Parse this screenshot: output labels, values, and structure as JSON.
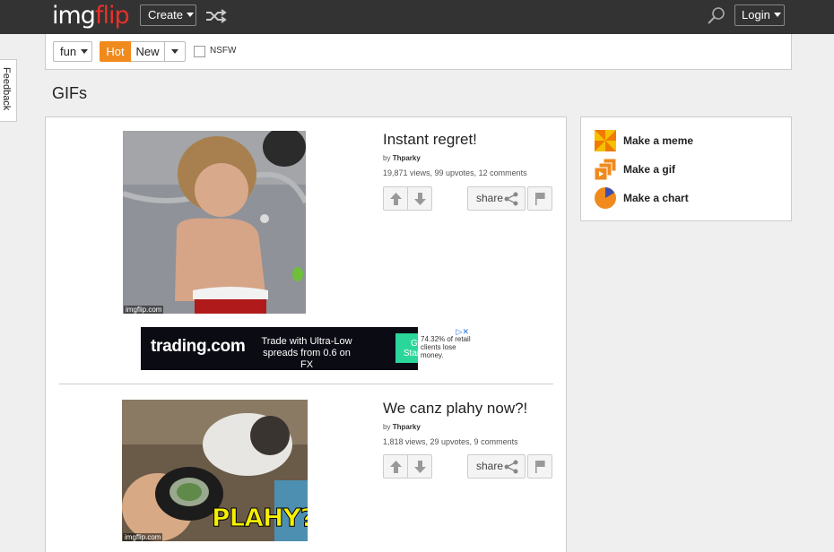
{
  "header": {
    "logo_part1": "img",
    "logo_part2": "flip",
    "create_label": "Create",
    "login_label": "Login"
  },
  "feedback_label": "Feedback",
  "filters": {
    "category": "fun",
    "hot_label": "Hot",
    "new_label": "New",
    "nsfw_label": "NSFW"
  },
  "page_title": "GIFs",
  "posts": [
    {
      "title": "Instant regret!",
      "by_prefix": "by",
      "author": "Thparky",
      "stats": "19,871 views, 99 upvotes, 12 comments",
      "share_label": "share",
      "watermark": "imgflip.com"
    },
    {
      "title": "We canz plahy now?!",
      "by_prefix": "by",
      "author": "Thparky",
      "stats": "1,818 views, 29 upvotes, 9 comments",
      "share_label": "share",
      "watermark": "imgflip.com",
      "caption": "PLAHY?"
    }
  ],
  "ad": {
    "brand": "trading.com",
    "tagline": "Trade with Ultra-Low spreads from 0.6 on FX",
    "cta": "Get Started",
    "disclaimer": "74.32% of retail clients lose money."
  },
  "sidebar": {
    "items": [
      {
        "label": "Make a meme"
      },
      {
        "label": "Make a gif"
      },
      {
        "label": "Make a chart"
      }
    ]
  },
  "colors": {
    "topbar": "#333333",
    "logo_accent": "#e8312a",
    "hot_orange": "#f08a1d",
    "ad_cta": "#2ad69a"
  }
}
